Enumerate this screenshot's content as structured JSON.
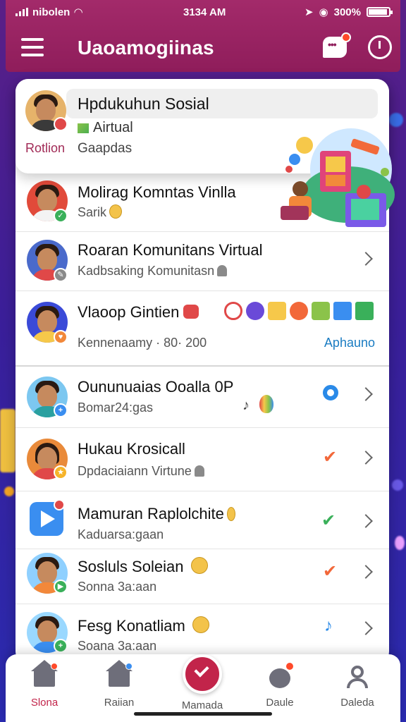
{
  "status_bar": {
    "carrier": "nibolen",
    "time": "3134 AM",
    "battery": "300%"
  },
  "header": {
    "title": "Uaoamogiinas",
    "chat_badge": "",
    "accent": "#8f1d5b"
  },
  "featured": {
    "title": "Hpdukuhun Sosial",
    "subtitle": "Airtual",
    "side_label": "Rotlion",
    "subtitle2": "Gaapdas"
  },
  "rows": [
    {
      "title": "Molirag Komntas Vinlla",
      "sub": "Sarik"
    },
    {
      "title": "Roaran Komunitans Virtual",
      "sub": "Kadbsaking Komunitasn"
    },
    {
      "title": "Vlaoop Gintien",
      "sub": "Kennenaamy · 80· 200",
      "action": "Aphauno"
    },
    {
      "title": "Oununuaias Ooalla 0P",
      "sub": "Bomar24:gas"
    },
    {
      "title": "Hukau Krosicall",
      "sub": "Dpdaciaiann Virtune"
    },
    {
      "title": "Mamuran Raplolchite",
      "sub": "Kaduarsa:gaan"
    },
    {
      "title": "Sosluls Soleian",
      "sub": "Sonna 3a:aan"
    },
    {
      "title": "Fesg Konatliam",
      "sub": "Soana 3a:aan"
    }
  ],
  "bottom_nav": [
    {
      "label": "Slona",
      "active": true
    },
    {
      "label": "Raiian"
    },
    {
      "label": "Mamada"
    },
    {
      "label": "Daule"
    },
    {
      "label": "Daleda"
    }
  ]
}
